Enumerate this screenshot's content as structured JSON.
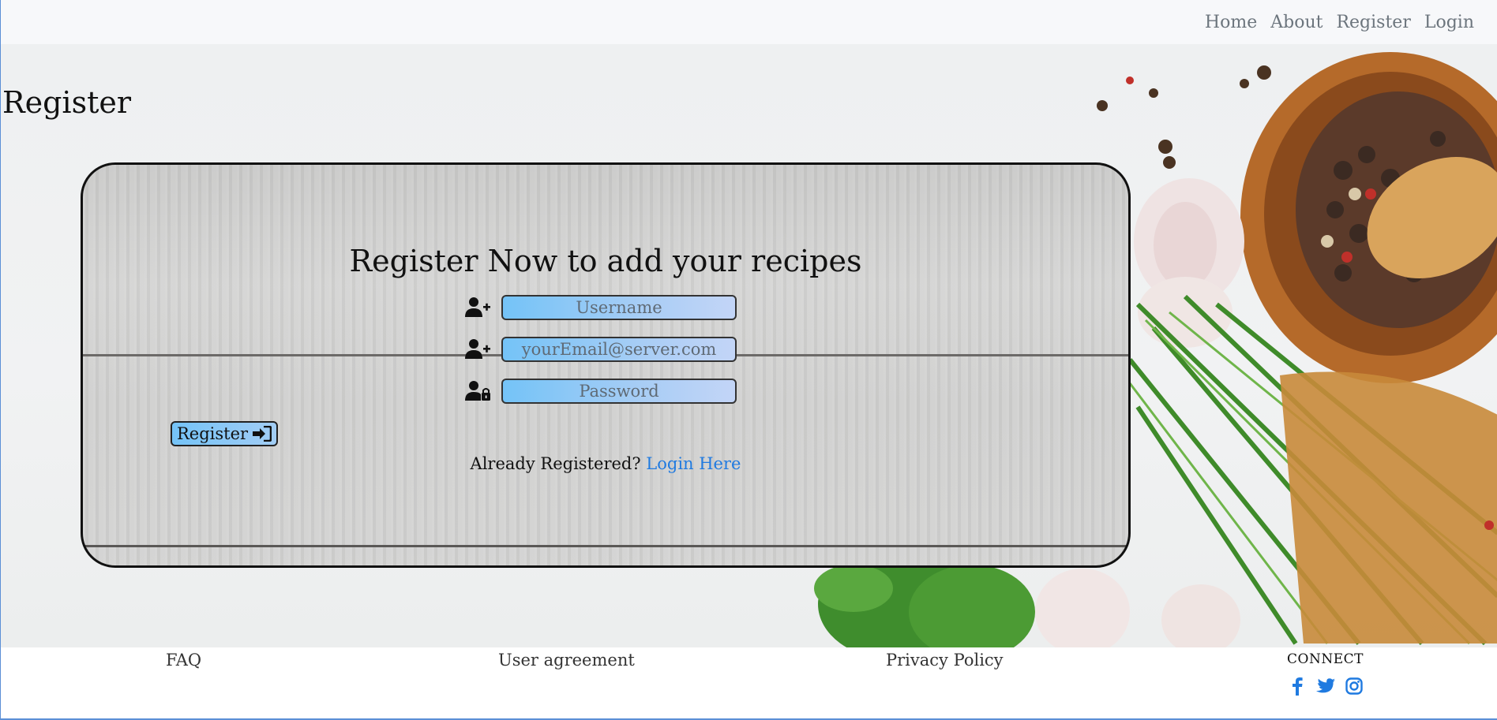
{
  "nav": {
    "items": [
      {
        "label": "Home"
      },
      {
        "label": "About"
      },
      {
        "label": "Register"
      },
      {
        "label": "Login"
      }
    ]
  },
  "page": {
    "title": "Register"
  },
  "form": {
    "heading": "Register Now to add your recipes",
    "username": {
      "placeholder": "Username",
      "value": "",
      "icon": "user-plus-icon"
    },
    "email": {
      "placeholder": "yourEmail@server.com",
      "value": "",
      "icon": "user-plus-icon"
    },
    "password": {
      "placeholder": "Password",
      "value": "",
      "icon": "user-lock-icon"
    },
    "submit_label": "Register",
    "submit_icon": "sign-in-icon",
    "already_text": "Already Registered?",
    "login_link": "Login Here"
  },
  "footer": {
    "links": [
      {
        "label": "FAQ"
      },
      {
        "label": "User agreement"
      },
      {
        "label": "Privacy Policy"
      }
    ],
    "connect_label": "CONNECT",
    "social": [
      "facebook-icon",
      "twitter-icon",
      "instagram-icon"
    ]
  },
  "colors": {
    "accent_blue": "#1f7ae0",
    "input_gradient_start": "#74c3f7",
    "nav_text": "#6c757d"
  }
}
